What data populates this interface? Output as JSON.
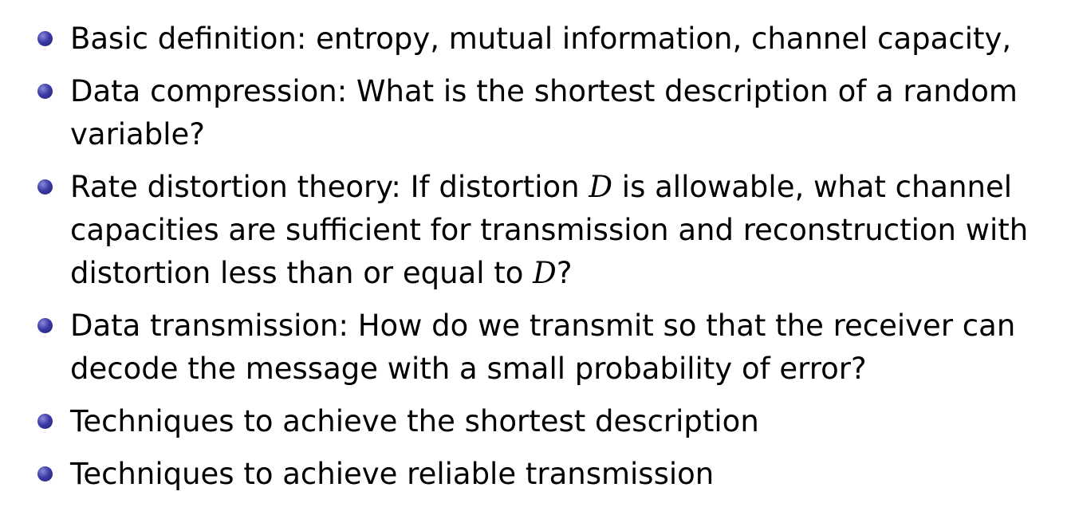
{
  "bullets": [
    {
      "id": "basic-definition",
      "parts": [
        "Basic definition:  entropy, mutual information, channel capacity,"
      ]
    },
    {
      "id": "data-compression",
      "parts": [
        "Data compression:  What is the shortest description of a random variable?"
      ]
    },
    {
      "id": "rate-distortion",
      "parts": [
        "Rate distortion theory:  If distortion ",
        "D",
        " is allowable, what channel capacities are sufficient for transmission and reconstruction with distortion less than or equal to ",
        "D",
        "?"
      ]
    },
    {
      "id": "data-transmission",
      "parts": [
        "Data transmission:  How do we transmit so that the receiver can decode the message with a small probability of error?"
      ]
    },
    {
      "id": "shortest-description",
      "parts": [
        "Techniques to achieve the shortest description"
      ]
    },
    {
      "id": "reliable-transmission",
      "parts": [
        "Techniques to achieve reliable transmission"
      ]
    }
  ],
  "colors": {
    "bullet": "#3b3ba6",
    "text": "#000000",
    "background": "#ffffff"
  }
}
